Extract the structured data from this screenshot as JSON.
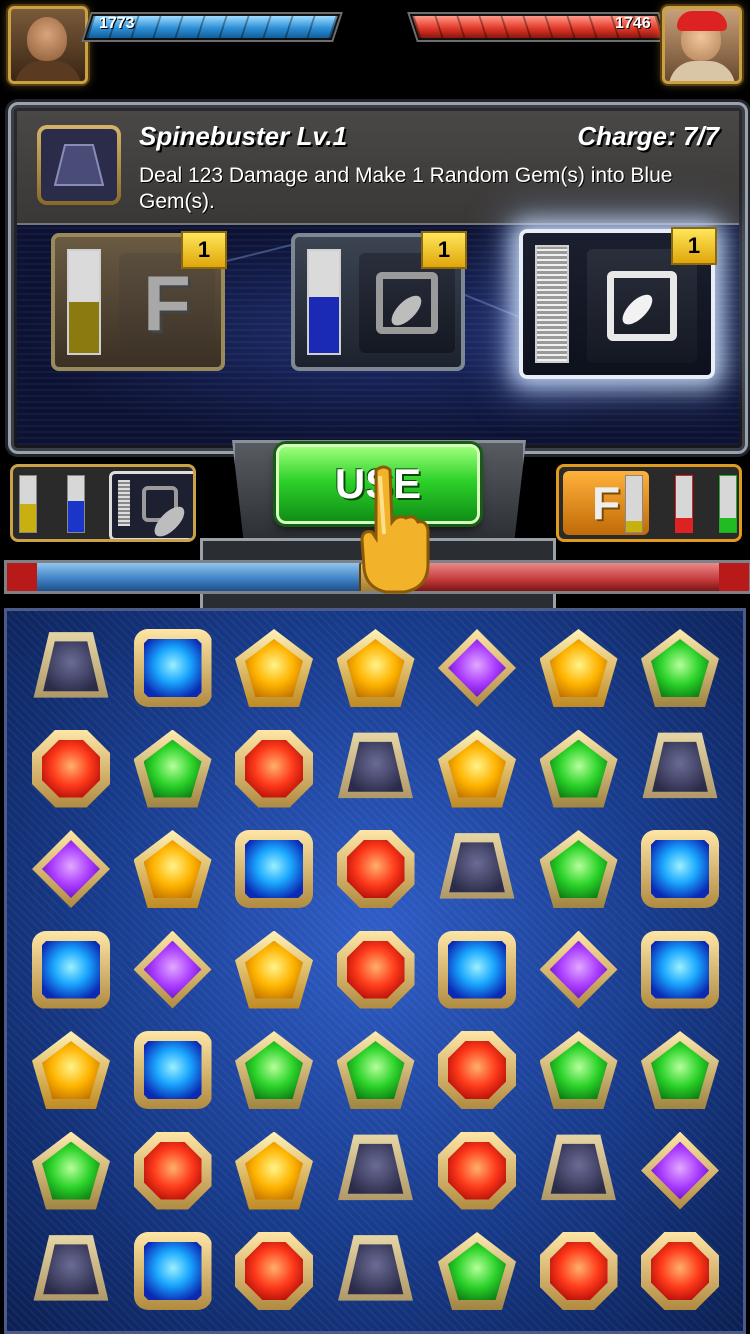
{
  "player": {
    "hp": "1773",
    "health_fraction": 1.0,
    "avatar": "wrestler-portrait-left"
  },
  "opponent": {
    "hp": "1746",
    "health_fraction": 1.0,
    "avatar": "wrestler-portrait-right"
  },
  "skill": {
    "title": "Spinebuster Lv.1",
    "charge": "Charge: 7/7",
    "description": "Deal 123 Damage and Make 1 Random Gem(s) into Blue Gem(s).",
    "cards": [
      {
        "glyph": "F",
        "badge": "1",
        "meter_color": "#8a7a10",
        "meter_fill": 0.5
      },
      {
        "glyph": "brush-icon",
        "badge": "1",
        "meter_color": "#1a2ab4",
        "meter_fill": 0.55
      },
      {
        "glyph": "brush-icon",
        "badge": "1",
        "meter_color": "#d0d0d0",
        "meter_fill": 1.0
      }
    ]
  },
  "use_button": {
    "label": "USE"
  },
  "tug_of_war": {
    "player_fraction": 0.48
  },
  "colors": {
    "accent": "#2ed22a",
    "player": "#2d8fd6",
    "opponent": "#e23a2a"
  },
  "board": {
    "rows": 7,
    "cols": 7,
    "gems": [
      [
        "gray",
        "blue",
        "yellow",
        "yellow",
        "purple",
        "yellow",
        "green"
      ],
      [
        "red",
        "green",
        "red",
        "gray",
        "yellow",
        "green",
        "gray"
      ],
      [
        "purple",
        "yellow",
        "blue",
        "red",
        "gray",
        "green",
        "blue"
      ],
      [
        "blue",
        "purple",
        "yellow",
        "red",
        "blue",
        "purple",
        "blue"
      ],
      [
        "yellow",
        "blue",
        "green",
        "green",
        "red",
        "green",
        "green"
      ],
      [
        "green",
        "red",
        "yellow",
        "gray",
        "red",
        "gray",
        "purple"
      ],
      [
        "gray",
        "blue",
        "red",
        "gray",
        "green",
        "red",
        "red"
      ]
    ]
  }
}
